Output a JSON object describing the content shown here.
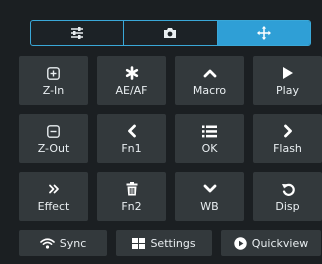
{
  "mode_tabs": [
    {
      "icon": "sliders-icon",
      "active": false
    },
    {
      "icon": "camera-icon",
      "active": false
    },
    {
      "icon": "move-arrows-icon",
      "active": true
    }
  ],
  "buttons": [
    {
      "label": "Z-In",
      "icon": "plus-square-icon"
    },
    {
      "label": "AE/AF",
      "icon": "asterisk-icon"
    },
    {
      "label": "Macro",
      "icon": "chevron-up-icon"
    },
    {
      "label": "Play",
      "icon": "play-icon"
    },
    {
      "label": "Z-Out",
      "icon": "minus-square-icon"
    },
    {
      "label": "Fn1",
      "icon": "chevron-left-icon"
    },
    {
      "label": "OK",
      "icon": "list-icon"
    },
    {
      "label": "Flash",
      "icon": "chevron-right-icon"
    },
    {
      "label": "Effect",
      "icon": "double-chevron-right-icon"
    },
    {
      "label": "Fn2",
      "icon": "trash-icon"
    },
    {
      "label": "WB",
      "icon": "chevron-down-icon"
    },
    {
      "label": "Disp",
      "icon": "undo-icon"
    }
  ],
  "bottom_bar": {
    "sync_label": "Sync",
    "settings_label": "Settings",
    "quickview_label": "Quickview"
  },
  "colors": {
    "accent": "#2f9fd6",
    "button": "#33393c",
    "background": "#1b1f22"
  }
}
